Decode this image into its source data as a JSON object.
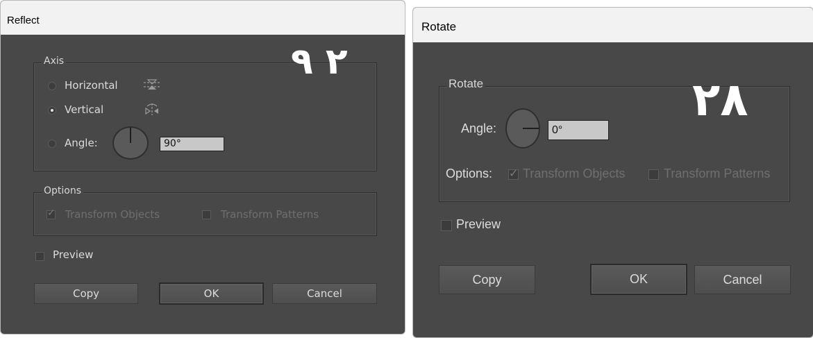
{
  "reflect": {
    "title": "Reflect",
    "number": "٢ ٩",
    "axis": {
      "legend": "Axis",
      "horizontal_label": "Horizontal",
      "vertical_label": "Vertical",
      "angle_label": "Angle:",
      "angle_value": "90°",
      "selected": "vertical"
    },
    "options": {
      "legend": "Options",
      "transform_objects": "Transform Objects",
      "transform_patterns": "Transform Patterns",
      "transform_objects_checked": true,
      "transform_patterns_checked": false
    },
    "preview_label": "Preview",
    "buttons": {
      "copy": "Copy",
      "ok": "OK",
      "cancel": "Cancel"
    }
  },
  "rotate": {
    "title": "Rotate",
    "number": "٢٨",
    "group": {
      "legend": "Rotate",
      "angle_label": "Angle:",
      "angle_value": "0°",
      "options_label": "Options:",
      "transform_objects": "Transform Objects",
      "transform_patterns": "Transform Patterns",
      "transform_objects_checked": true,
      "transform_patterns_checked": false
    },
    "preview_label": "Preview",
    "buttons": {
      "copy": "Copy",
      "ok": "OK",
      "cancel": "Cancel"
    }
  },
  "colors": {
    "dialog_bg": "#484848",
    "titlebar_bg": "#f2f2f2",
    "field_bg": "#c8c8c8",
    "text": "#dcdcdc",
    "disabled_text": "#6f6f6f"
  }
}
